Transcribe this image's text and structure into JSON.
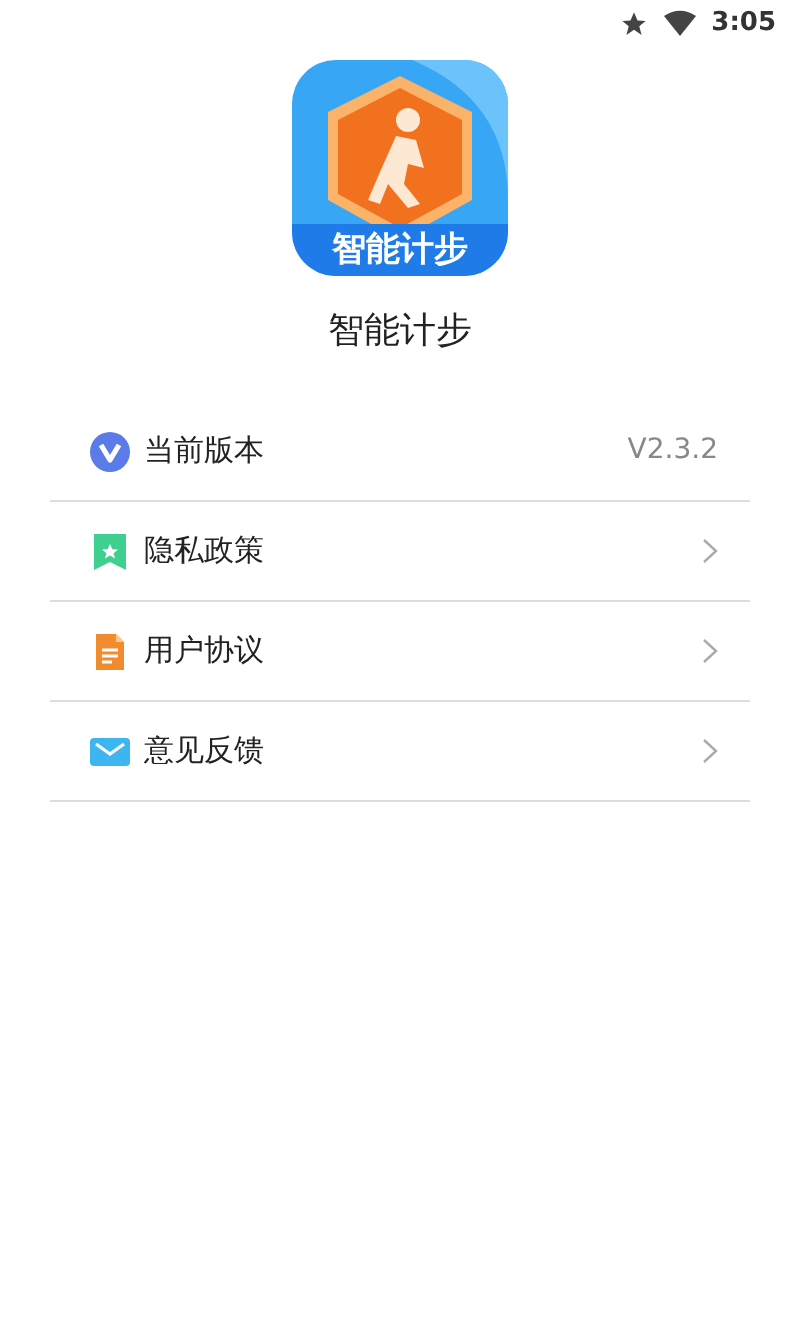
{
  "status_bar": {
    "time": "3:05"
  },
  "app": {
    "icon_label": "智能计步",
    "name": "智能计步"
  },
  "rows": [
    {
      "kind": "version",
      "label": "当前版本",
      "value": "V2.3.2"
    },
    {
      "kind": "privacy",
      "label": "隐私政策"
    },
    {
      "kind": "agreement",
      "label": "用户协议"
    },
    {
      "kind": "feedback",
      "label": "意见反馈"
    }
  ]
}
